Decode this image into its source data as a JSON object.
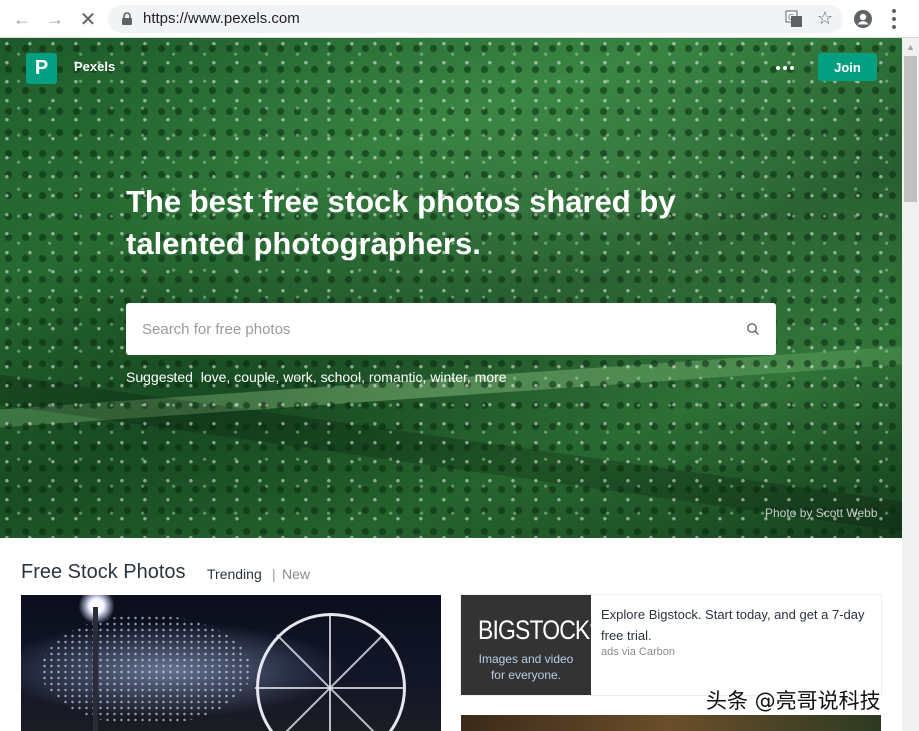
{
  "browser": {
    "url": "https://www.pexels.com",
    "icons": [
      "back-icon",
      "forward-icon",
      "stop-icon",
      "lock-icon",
      "translate-icon",
      "star-icon",
      "account-icon",
      "menu-icon"
    ]
  },
  "header": {
    "logo_letter": "P",
    "brand": "Pexels",
    "join_label": "Join"
  },
  "hero": {
    "headline": "The best free stock photos shared by talented photographers.",
    "search_placeholder": "Search for free photos",
    "suggested_label": "Suggested",
    "suggestions": [
      "love",
      "couple",
      "work",
      "school",
      "romantic",
      "winter",
      "more"
    ],
    "credit": "Photo by Scott Webb"
  },
  "section": {
    "title": "Free Stock Photos",
    "tab_trending": "Trending",
    "separator": "|",
    "tab_new": "New"
  },
  "ad": {
    "logo": "BIGSTOCK",
    "logo_mark": "™",
    "tagline_line1": "Images and video",
    "tagline_line2": "for everyone.",
    "text": "Explore Bigstock. Start today, and get a 7-day free trial.",
    "via": "ads via Carbon"
  },
  "watermark": "头条 @亮哥说科技",
  "colors": {
    "brand_green": "#05a081",
    "text_dark": "#2c343e"
  }
}
